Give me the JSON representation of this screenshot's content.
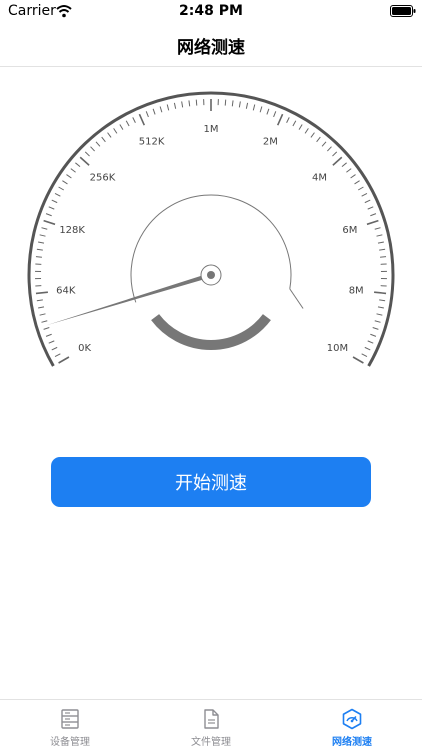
{
  "status_bar": {
    "carrier": "Carrier",
    "time": "2:48 PM"
  },
  "nav": {
    "title": "网络测速"
  },
  "gauge": {
    "labels": [
      "0K",
      "64K",
      "128K",
      "256K",
      "512K",
      "1M",
      "2M",
      "4M",
      "6M",
      "8M",
      "10M"
    ],
    "value_label": "0K",
    "colors": {
      "arc": "#555555",
      "ticks": "#666666",
      "needle": "#777777",
      "bar": "#777777"
    }
  },
  "start_button": {
    "label": "开始测速",
    "color": "#1d7ff2"
  },
  "tabs": [
    {
      "label": "设备管理",
      "icon": "server-icon",
      "active": false
    },
    {
      "label": "文件管理",
      "icon": "file-icon",
      "active": false
    },
    {
      "label": "网络测速",
      "icon": "speed-test-icon",
      "active": true
    }
  ]
}
